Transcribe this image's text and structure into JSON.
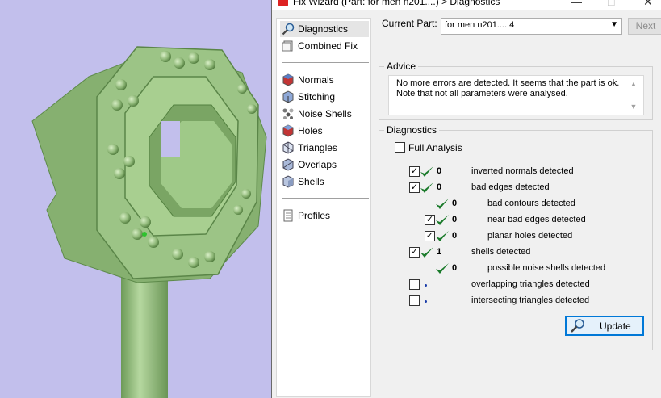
{
  "window": {
    "title": "Fix Wizard (Part: for men n201....) > Diagnostics",
    "minimize": "—",
    "maximize": "□",
    "close": "✕"
  },
  "nav": {
    "items": [
      {
        "label": "Diagnostics",
        "icon": "magnifier-icon",
        "selected": true
      },
      {
        "label": "Combined Fix",
        "icon": "combined-fix-icon"
      },
      {
        "label": "Normals",
        "icon": "normals-icon"
      },
      {
        "label": "Stitching",
        "icon": "stitching-icon"
      },
      {
        "label": "Noise Shells",
        "icon": "noise-shells-icon"
      },
      {
        "label": "Holes",
        "icon": "holes-icon"
      },
      {
        "label": "Triangles",
        "icon": "triangles-icon"
      },
      {
        "label": "Overlaps",
        "icon": "overlaps-icon"
      },
      {
        "label": "Shells",
        "icon": "shells-icon"
      },
      {
        "label": "Profiles",
        "icon": "profiles-icon"
      }
    ]
  },
  "header": {
    "current_part_label": "Current Part:",
    "current_part_value": "for men n201.....4",
    "next_label": "Next"
  },
  "advice": {
    "title": "Advice",
    "text_line1": "No more errors are detected. It seems that the part is ok.",
    "text_line2": "Note that not all parameters were analysed."
  },
  "diagnostics": {
    "title": "Diagnostics",
    "full_analysis_label": "Full Analysis",
    "full_analysis_checked": false,
    "rows": [
      {
        "checked": true,
        "status": "ok",
        "count": "0",
        "label": "inverted normals detected"
      },
      {
        "checked": true,
        "status": "ok",
        "count": "0",
        "label": "bad edges detected"
      },
      {
        "checked": null,
        "status": "ok",
        "count": "0",
        "label": "bad contours detected"
      },
      {
        "checked": true,
        "status": "ok",
        "count": "0",
        "label": "near bad edges detected"
      },
      {
        "checked": true,
        "status": "ok",
        "count": "0",
        "label": "planar holes detected"
      },
      {
        "checked": true,
        "status": "ok",
        "count": "1",
        "label": "shells detected"
      },
      {
        "checked": null,
        "status": "ok",
        "count": "0",
        "label": "possible noise shells detected"
      },
      {
        "checked": false,
        "status": "pending",
        "count": "",
        "label": "overlapping triangles detected"
      },
      {
        "checked": false,
        "status": "pending",
        "count": "",
        "label": "intersecting triangles detected"
      }
    ],
    "update_label": "Update"
  },
  "colors": {
    "viewport_bg": "#c2bfec",
    "model_green": "#8fb878",
    "tick_green": "#1a7a2a",
    "accent_blue": "#0078d7"
  }
}
